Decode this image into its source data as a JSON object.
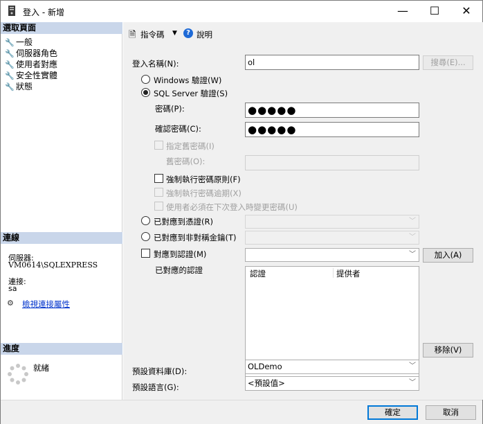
{
  "window": {
    "title": "登入 - 新增",
    "minimize": "—",
    "maximize": "☐",
    "close": "✕"
  },
  "left": {
    "select_page_header": "選取頁面",
    "nav_items": [
      "一般",
      "伺服器角色",
      "使用者對應",
      "安全性實體",
      "狀態"
    ],
    "connection_header": "連線",
    "server_label": "伺服器:",
    "server_value": "VM0614\\SQLEXPRESS",
    "connection_label": "連接:",
    "connection_value": "sa",
    "view_connection_link": "檢視連接屬性",
    "progress_header": "進度",
    "progress_status": "就緒"
  },
  "toolbar": {
    "script_label": "指令碼",
    "help_label": "說明"
  },
  "form": {
    "login_name_label": "登入名稱(N):",
    "login_name_value": "ol",
    "search_button": "搜尋(E)...",
    "windows_auth": "Windows 驗證(W)",
    "sql_auth": "SQL Server 驗證(S)",
    "password_label": "密碼(P):",
    "password_value": "●●●●●",
    "confirm_label": "確認密碼(C):",
    "confirm_value": "●●●●●",
    "specify_old_password": "指定舊密碼(I)",
    "old_password_label": "舊密碼(O):",
    "enforce_policy": "強制執行密碼原則(F)",
    "enforce_expiration": "強制執行密碼逾期(X)",
    "must_change": "使用者必須在下次登入時變更密碼(U)",
    "mapped_to_cert": "已對應到憑證(R)",
    "mapped_to_asym": "已對應到非對稱金鑰(T)",
    "map_to_credential": "對應到認證(M)",
    "add_button": "加入(A)",
    "mapped_credentials_label": "已對應的認證",
    "col_credential": "認證",
    "col_provider": "提供者",
    "remove_button": "移除(V)",
    "default_db_label": "預設資料庫(D):",
    "default_db_value": "OLDemo",
    "default_lang_label": "預設語言(G):",
    "default_lang_value": "<預設值>"
  },
  "footer": {
    "ok": "確定",
    "cancel": "取消"
  }
}
